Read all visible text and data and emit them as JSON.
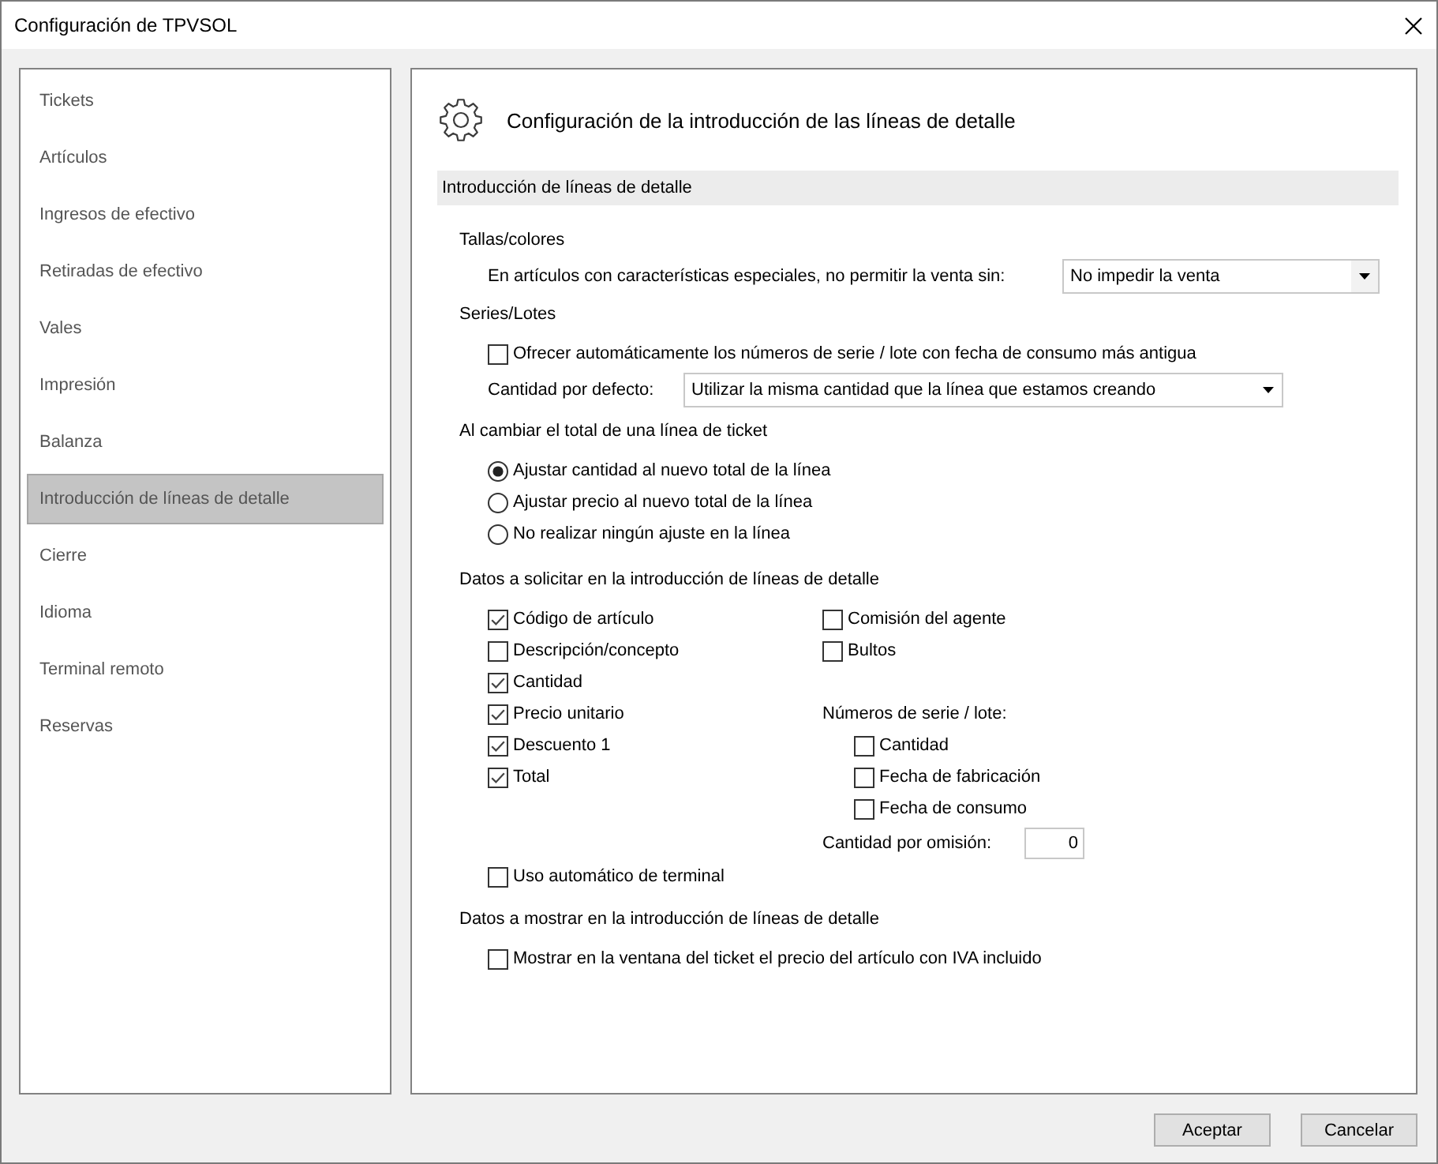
{
  "window": {
    "title": "Configuración de TPVSOL"
  },
  "sidebar": {
    "items": [
      {
        "label": "Tickets",
        "selected": false
      },
      {
        "label": "Artículos",
        "selected": false
      },
      {
        "label": "Ingresos de efectivo",
        "selected": false
      },
      {
        "label": "Retiradas de efectivo",
        "selected": false
      },
      {
        "label": "Vales",
        "selected": false
      },
      {
        "label": "Impresión",
        "selected": false
      },
      {
        "label": "Balanza",
        "selected": false
      },
      {
        "label": "Introducción de líneas de detalle",
        "selected": true
      },
      {
        "label": "Cierre",
        "selected": false
      },
      {
        "label": "Idioma",
        "selected": false
      },
      {
        "label": "Terminal remoto",
        "selected": false
      },
      {
        "label": "Reservas",
        "selected": false
      }
    ]
  },
  "panel": {
    "title": "Configuración de la introducción de las líneas de detalle",
    "section": "Introducción de líneas de detalle"
  },
  "sizes_colors": {
    "heading": "Tallas/colores",
    "label": "En artículos con características especiales, no permitir la venta sin:",
    "value": "No impedir la venta"
  },
  "series_lots": {
    "heading": "Series/Lotes",
    "auto_offer": {
      "label": "Ofrecer automáticamente los números de serie / lote con fecha de consumo más antigua",
      "checked": false
    },
    "quantity_label": "Cantidad por defecto:",
    "quantity_value": "Utilizar la misma cantidad que la línea que estamos creando"
  },
  "total_change": {
    "heading": "Al cambiar el total de una línea de ticket",
    "options": [
      {
        "label": "Ajustar cantidad al nuevo total de la línea",
        "selected": true
      },
      {
        "label": "Ajustar precio al nuevo total de la línea",
        "selected": false
      },
      {
        "label": "No realizar ningún ajuste en la línea",
        "selected": false
      }
    ]
  },
  "data_request": {
    "heading": "Datos a solicitar en la introducción de líneas de detalle",
    "left": [
      {
        "label": "Código de artículo",
        "checked": true
      },
      {
        "label": "Descripción/concepto",
        "checked": false
      },
      {
        "label": "Cantidad",
        "checked": true
      },
      {
        "label": "Precio unitario",
        "checked": true
      },
      {
        "label": "Descuento 1",
        "checked": true
      },
      {
        "label": "Total",
        "checked": true
      }
    ],
    "right": [
      {
        "label": "Comisión del agente",
        "checked": false
      },
      {
        "label": "Bultos",
        "checked": false
      }
    ],
    "serial_heading": "Números de serie / lote:",
    "serial": [
      {
        "label": "Cantidad",
        "checked": false
      },
      {
        "label": "Fecha de fabricación",
        "checked": false
      },
      {
        "label": "Fecha de consumo",
        "checked": false
      }
    ],
    "default_quantity_label": "Cantidad por omisión:",
    "default_quantity": "0",
    "auto_terminal": {
      "label": "Uso automático de terminal",
      "checked": false
    }
  },
  "data_show": {
    "heading": "Datos a mostrar en la introducción de líneas de detalle",
    "options": [
      {
        "label": "Mostrar en la ventana del ticket el precio del artículo con IVA incluido",
        "checked": false
      }
    ]
  },
  "buttons": [
    "Aceptar",
    "Cancelar"
  ]
}
